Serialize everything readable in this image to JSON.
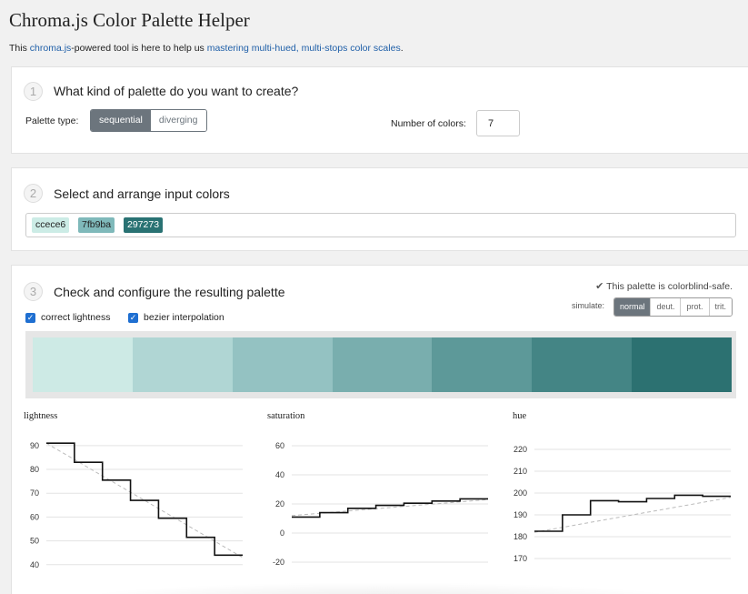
{
  "header": {
    "title": "Chroma.js Color Palette Helper",
    "subtitle_pre": "This ",
    "subtitle_link1": "chroma.js",
    "subtitle_mid": "-powered tool is here to help us ",
    "subtitle_link2": "mastering multi-hued, multi-stops color scales",
    "subtitle_post": "."
  },
  "step1": {
    "num": "1",
    "title": "What kind of palette do you want to create?",
    "palette_type_label": "Palette type:",
    "options": [
      "sequential",
      "diverging"
    ],
    "selected": "sequential",
    "num_colors_label": "Number of colors:",
    "num_colors_value": "7"
  },
  "step2": {
    "num": "2",
    "title": "Select and arrange input colors",
    "colors": [
      {
        "label": "ccece6",
        "hex": "#ccece6",
        "text": "#222"
      },
      {
        "label": "7fb9ba",
        "hex": "#7fb9ba",
        "text": "#222"
      },
      {
        "label": "297273",
        "hex": "#297273",
        "text": "#ffffff"
      }
    ]
  },
  "step3": {
    "num": "3",
    "title": "Check and configure the resulting palette",
    "correct_lightness_label": "correct lightness",
    "bezier_label": "bezier interpolation",
    "colorblind_note": "This palette is colorblind-safe.",
    "simulate_label": "simulate:",
    "simulate_options": [
      "normal",
      "deut.",
      "prot.",
      "trit."
    ],
    "simulate_selected": "normal",
    "palette": [
      "#cdeae5",
      "#b0d6d4",
      "#94c2c2",
      "#79aeae",
      "#5d9999",
      "#448585",
      "#2c7171"
    ]
  },
  "charts": {
    "lightness": {
      "label": "lightness",
      "ticks": [
        90,
        80,
        70,
        60,
        50,
        40
      ],
      "ylim": [
        38,
        93
      ],
      "steps": [
        91,
        83,
        75.5,
        67,
        59.5,
        51.5,
        44
      ],
      "line": [
        91,
        43
      ]
    },
    "saturation": {
      "label": "saturation",
      "ticks": [
        60,
        40,
        20,
        0,
        -20
      ],
      "ylim": [
        -25,
        65
      ],
      "steps": [
        11,
        14,
        17,
        19,
        20.5,
        22,
        23.5
      ],
      "line": [
        12,
        23
      ]
    },
    "hue": {
      "label": "hue",
      "ticks": [
        220,
        210,
        200,
        190,
        180,
        170
      ],
      "ylim": [
        165,
        225
      ],
      "steps": [
        182.5,
        190,
        196.5,
        196,
        197.5,
        199,
        198.5
      ],
      "line": [
        182,
        198
      ]
    }
  },
  "colors": {
    "accent": "#6c757d",
    "link": "#1f5fa8",
    "checkbox": "#1f6fd1"
  }
}
